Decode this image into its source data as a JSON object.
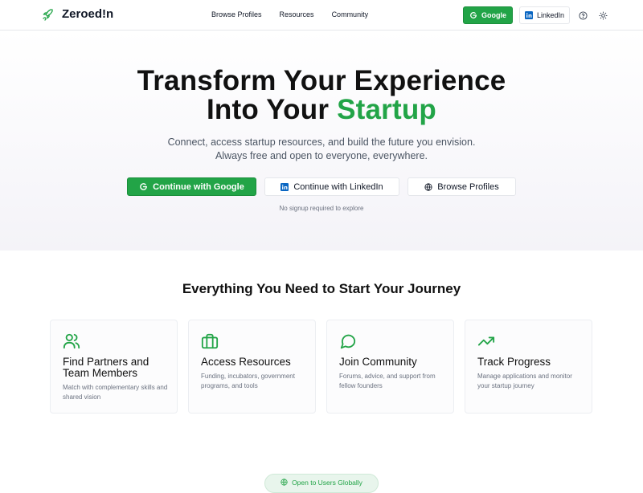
{
  "header": {
    "brand_name": "Zeroed!n",
    "nav": [
      "Browse Profiles",
      "Resources",
      "Community"
    ],
    "google_label": "Google",
    "linkedin_label": "LinkedIn",
    "icons": {
      "brand": "rocket-icon",
      "google": "google-g-icon",
      "linkedin": "linkedin-icon",
      "help": "help-circle-icon",
      "theme": "sun-icon"
    }
  },
  "hero": {
    "title_line1": "Transform Your Experience",
    "title_line2_prefix": "Into Your ",
    "title_line2_accent": "Startup",
    "subtitle_line1": "Connect, access startup resources, and build the future you envision.",
    "subtitle_line2": "Always free and open to everyone, everywhere.",
    "cta_google": "Continue with Google",
    "cta_linkedin": "Continue with LinkedIn",
    "cta_browse": "Browse Profiles",
    "note": "No signup required to explore",
    "icons": {
      "browse": "globe-icon"
    }
  },
  "features": {
    "title": "Everything You Need to Start Your Journey",
    "cards": [
      {
        "icon": "users-icon",
        "title": "Find Partners and Team Members",
        "desc": "Match with complementary skills and shared vision"
      },
      {
        "icon": "briefcase-icon",
        "title": "Access Resources",
        "desc": "Funding, incubators, government programs, and tools"
      },
      {
        "icon": "message-circle-icon",
        "title": "Join Community",
        "desc": "Forums, advice, and support from fellow founders"
      },
      {
        "icon": "trending-up-icon",
        "title": "Track Progress",
        "desc": "Manage applications and monitor your startup journey"
      }
    ]
  },
  "badge": {
    "label": "Open to Users Globally",
    "icon": "globe-icon"
  },
  "colors": {
    "accent": "#22a447",
    "text": "#111827",
    "muted": "#6b7280",
    "border": "#e5e7eb"
  }
}
